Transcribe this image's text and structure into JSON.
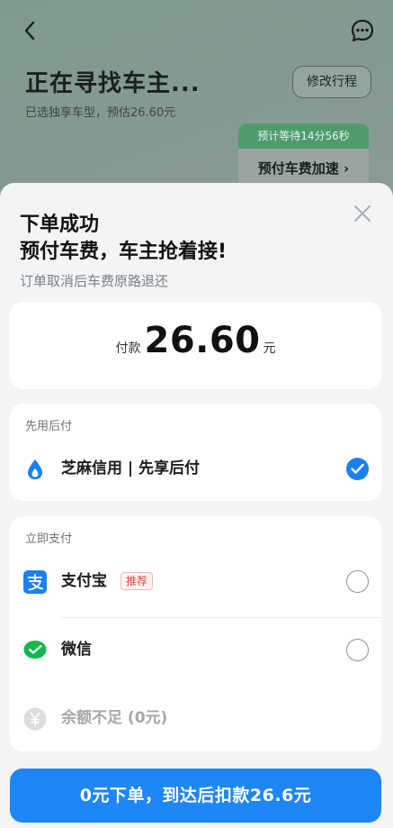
{
  "header": {
    "title": "正在寻找车主...",
    "subtitle": "已选独享车型，预估26.60元",
    "edit_trip_label": "修改行程",
    "wait_text": "预计等待14分56秒",
    "speedup_label": "预付车费加速 ›"
  },
  "sheet": {
    "title_line1": "下单成功",
    "title_line2": "预付车费，车主抢着接!",
    "note": "订单取消后车费原路退还",
    "amount": {
      "prefix": "付款",
      "value": "26.60",
      "unit": "元"
    },
    "pay_later": {
      "section_title": "先用后付",
      "options": [
        {
          "label": "芝麻信用 | 先享后付",
          "icon": "sesame-credit-icon",
          "checked": true
        }
      ]
    },
    "pay_now": {
      "section_title": "立即支付",
      "options": [
        {
          "label": "支付宝",
          "icon": "alipay-icon",
          "badge": "推荐",
          "checked": false
        },
        {
          "label": "微信",
          "icon": "wechat-icon",
          "checked": false
        },
        {
          "label": "余额不足 (0元)",
          "icon": "balance-yuan-icon",
          "disabled": true
        }
      ]
    },
    "submit_label": "0元下单，到达后扣款26.6元"
  },
  "colors": {
    "accent": "#1e86f7",
    "badge_red": "#e0463e",
    "wait_green": "#4e9b6c"
  }
}
